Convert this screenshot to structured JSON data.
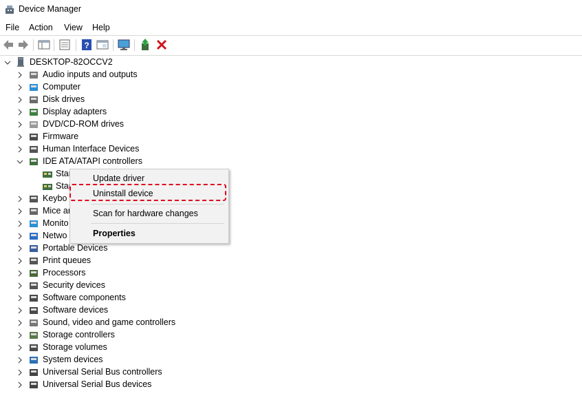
{
  "window": {
    "title": "Device Manager"
  },
  "menu": [
    "File",
    "Action",
    "View",
    "Help"
  ],
  "toolbar": {
    "icons": [
      "back-icon",
      "forward-icon",
      "properties-grid-icon",
      "console-tree-icon",
      "help-icon",
      "show-hide-icon",
      "monitor-scan-icon",
      "update-driver-icon",
      "uninstall-icon"
    ]
  },
  "tree": {
    "root": "DESKTOP-82OCCV2",
    "categories": [
      "Audio inputs and outputs",
      "Computer",
      "Disk drives",
      "Display adapters",
      "DVD/CD-ROM drives",
      "Firmware",
      "Human Interface Devices",
      "IDE ATA/ATAPI controllers",
      "Keyboards",
      "Mice and other pointing devices",
      "Monitors",
      "Network adapters",
      "Portable Devices",
      "Print queues",
      "Processors",
      "Security devices",
      "Software components",
      "Software devices",
      "Sound, video and game controllers",
      "Storage controllers",
      "Storage volumes",
      "System devices",
      "Universal Serial Bus controllers",
      "Universal Serial Bus devices"
    ],
    "visible_truncated": {
      "keyboards": "Keybo",
      "mice": "Mice ar",
      "monitors": "Monito",
      "network": "Netwo"
    },
    "ide_children": [
      "Stan",
      "Stan"
    ]
  },
  "context_menu": {
    "items": [
      "Update driver",
      "Uninstall device",
      "Scan for hardware changes",
      "Properties"
    ]
  },
  "colors": {
    "highlight": "#e0001b",
    "menu_bg": "#f2f2f2"
  }
}
